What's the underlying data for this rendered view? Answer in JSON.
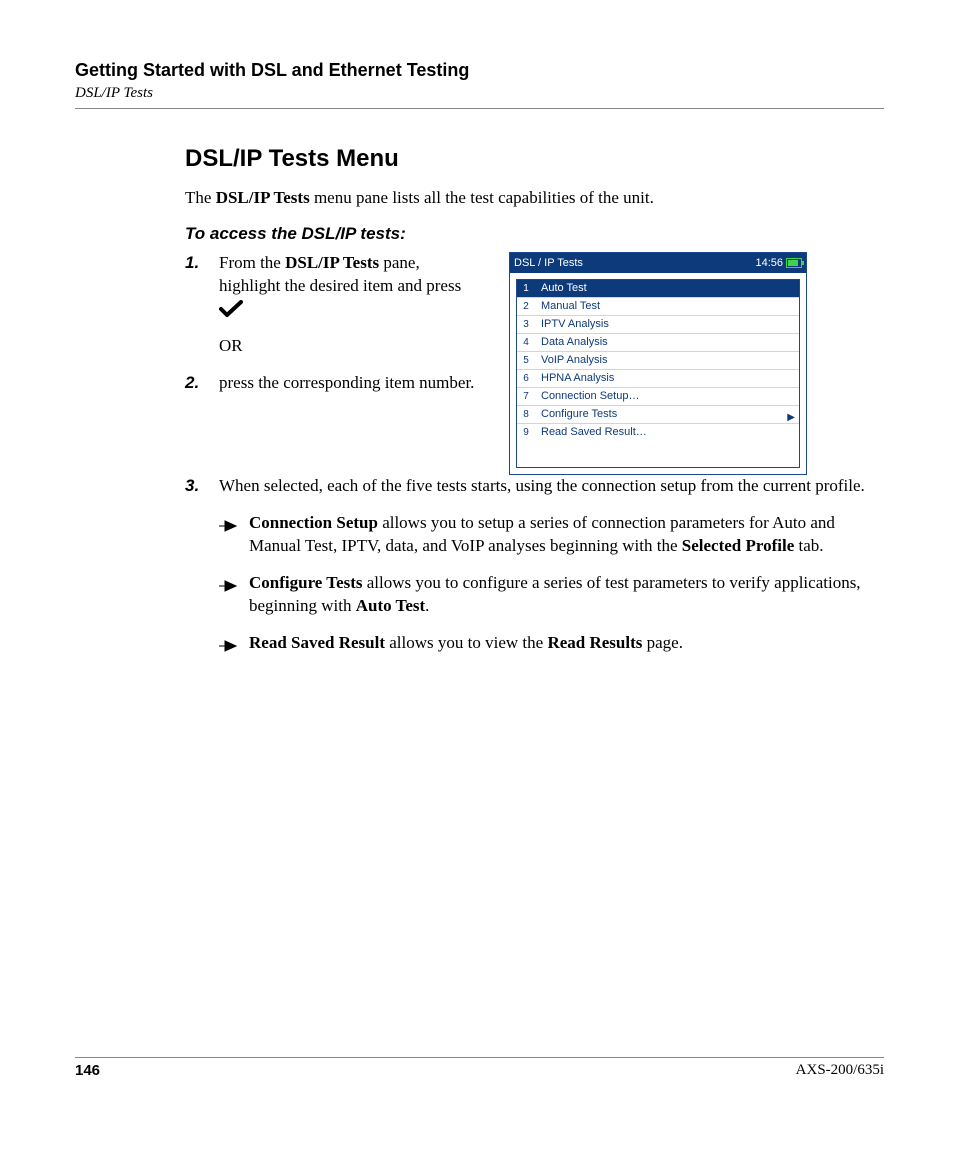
{
  "header": {
    "chapter": "Getting Started with DSL and Ethernet Testing",
    "breadcrumb": "DSL/IP Tests"
  },
  "section": {
    "heading": "DSL/IP Tests Menu",
    "lead_pre": "The ",
    "lead_bold": "DSL/IP Tests",
    "lead_post": " menu pane lists all the test capabilities of the unit.",
    "subhead": "To access the DSL/IP tests:"
  },
  "steps": {
    "s1_pre": "From the ",
    "s1_bold": "DSL/IP Tests",
    "s1_post": " pane, highlight the desired item and press ",
    "s1_or": "OR",
    "s2": "press the corresponding item number.",
    "s3": "When selected, each of the five tests starts, using the connection setup from the current profile."
  },
  "bullets": {
    "b1_bold": "Connection Setup",
    "b1_mid": " allows you to setup a series of connection parameters for Auto and Manual Test, IPTV, data, and VoIP analyses beginning with the ",
    "b1_bold2": "Selected Profile",
    "b1_end": " tab.",
    "b2_bold": "Configure Tests",
    "b2_mid": " allows you to configure a series of test parameters to verify applications, beginning with ",
    "b2_bold2": "Auto Test",
    "b2_end": ".",
    "b3_bold": "Read Saved Result",
    "b3_mid": " allows you to view the ",
    "b3_bold2": "Read Results",
    "b3_end": " page."
  },
  "device": {
    "title": "DSL / IP Tests",
    "time": "14:56",
    "items": [
      {
        "n": "1",
        "label": "Auto Test",
        "selected": true
      },
      {
        "n": "2",
        "label": "Manual Test"
      },
      {
        "n": "3",
        "label": "IPTV Analysis"
      },
      {
        "n": "4",
        "label": "Data Analysis"
      },
      {
        "n": "5",
        "label": "VoIP Analysis"
      },
      {
        "n": "6",
        "label": "HPNA Analysis"
      },
      {
        "n": "7",
        "label": "Connection Setup…"
      },
      {
        "n": "8",
        "label": "Configure Tests",
        "arrow": true
      },
      {
        "n": "9",
        "label": "Read Saved Result…"
      }
    ]
  },
  "footer": {
    "page": "146",
    "model": "AXS-200/635i"
  }
}
